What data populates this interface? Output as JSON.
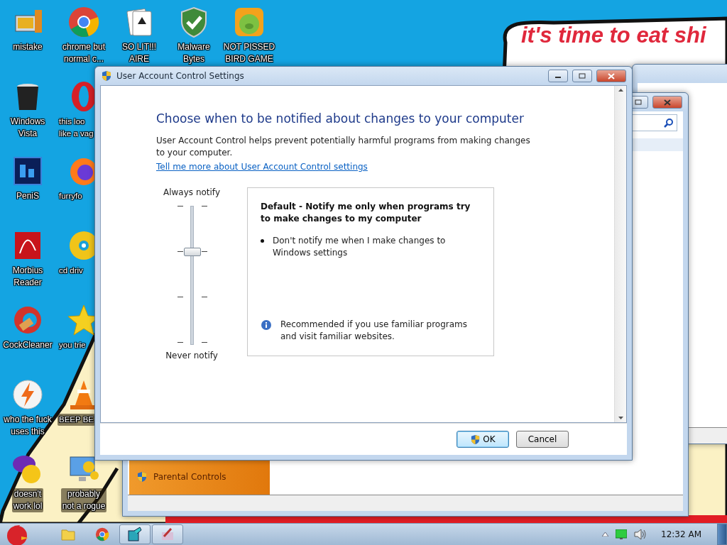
{
  "desktop_icons": [
    {
      "kind": "computer",
      "lines": [
        "mistake"
      ]
    },
    {
      "kind": "chrome",
      "lines": [
        "chrome but",
        "normal c..."
      ]
    },
    {
      "kind": "cards",
      "lines": [
        "SO LIT!!!",
        "AIRE"
      ]
    },
    {
      "kind": "shield",
      "lines": [
        "Malware",
        "Bytes"
      ]
    },
    {
      "kind": "pig",
      "lines": [
        "NOT PISSED",
        "BIRD GAME"
      ]
    },
    {
      "kind": "bin",
      "lines": [
        "Windows",
        "Vista"
      ]
    },
    {
      "kind": "opera",
      "lines": [
        "this loo",
        "like a vag"
      ]
    },
    {
      "kind": "ps",
      "lines": [
        "PeniS"
      ]
    },
    {
      "kind": "firefox",
      "lines": [
        "furryfo"
      ]
    },
    {
      "kind": "pdf",
      "lines": [
        "Morbius",
        "Reader"
      ]
    },
    {
      "kind": "cd",
      "lines": [
        "cd driv"
      ]
    },
    {
      "kind": "cleaner",
      "lines": [
        "CockCleaner"
      ]
    },
    {
      "kind": "star",
      "lines": [
        "you trie"
      ]
    },
    {
      "kind": "bolt",
      "lines": [
        "who the fuck",
        "uses this"
      ]
    },
    {
      "kind": "cone",
      "lines": [
        "BEEP BE"
      ]
    },
    {
      "kind": "yahoo",
      "lines": [
        "doesn't",
        "work lol"
      ]
    },
    {
      "kind": "gears",
      "lines": [
        "probably",
        "not a rogue"
      ]
    }
  ],
  "banner": {
    "text": "it's time to eat shi"
  },
  "back_window": {
    "tile": {
      "label": "Parental Controls"
    }
  },
  "dialog": {
    "title": "User Account Control Settings",
    "heading": "Choose when to be notified about changes to your computer",
    "description": "User Account Control helps prevent potentially harmful programs from making changes to your computer.",
    "link": "Tell me more about User Account Control settings",
    "slider": {
      "top_label": "Always notify",
      "bottom_label": "Never notify",
      "level": 0.667
    },
    "info": {
      "title": "Default - Notify me only when programs try to make changes to my computer",
      "bullet": "Don't notify me when I make changes to Windows settings",
      "note": "Recommended if you use familiar programs and visit familiar websites."
    },
    "buttons": [
      {
        "label": "OK",
        "shield": true,
        "default": true
      },
      {
        "label": "Cancel",
        "shield": false,
        "default": false
      }
    ]
  },
  "taskbar": {
    "pinned": [
      {
        "kind": "folder",
        "active": false
      },
      {
        "kind": "chrome",
        "active": false
      },
      {
        "kind": "tiles",
        "active": true
      },
      {
        "kind": "paint",
        "active": true
      }
    ],
    "clock": "12:32 AM"
  }
}
